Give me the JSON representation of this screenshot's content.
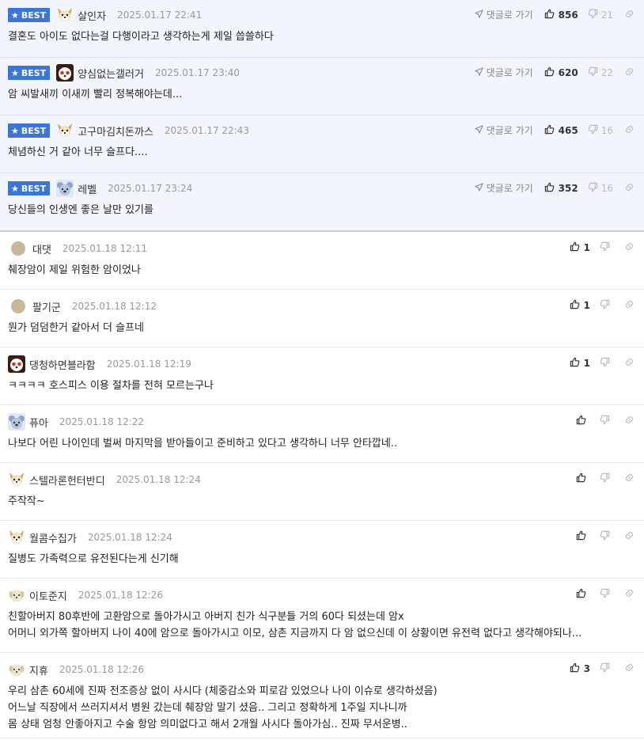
{
  "best_badge": "BEST",
  "reply_label": "댓글로 가기",
  "comments": [
    {
      "best": true,
      "avatar": "dog-avatar",
      "nick": "살인자",
      "date": "2025.01.17 22:41",
      "likes": "856",
      "dislikes": "21",
      "text": "결혼도 아이도 없다는걸 다행이라고 생각하는게 제일 씁쓸하다"
    },
    {
      "best": true,
      "avatar": "panda-avatar",
      "nick": "양심없는갤러거",
      "date": "2025.01.17 23:40",
      "likes": "620",
      "dislikes": "22",
      "text": "암 씨발새끼 이새끼 빨리 정복해야는데..."
    },
    {
      "best": true,
      "avatar": "dog-avatar",
      "nick": "고구마김치돈까스",
      "date": "2025.01.17 22:43",
      "likes": "465",
      "dislikes": "16",
      "text": "체념하신 거 같아 너무 슬프다...."
    },
    {
      "best": true,
      "avatar": "koala-avatar",
      "nick": "레벨",
      "date": "2025.01.17 23:24",
      "likes": "352",
      "dislikes": "16",
      "text": "당신들의 인생엔 좋은 날만 있기를"
    },
    {
      "best": false,
      "avatar": "dot-avatar",
      "nick": "대댓",
      "date": "2025.01.18 12:11",
      "likes": "1",
      "dislikes": "",
      "text": "췌장암이 제일 위험한 암이었나"
    },
    {
      "best": false,
      "avatar": "dot-avatar",
      "nick": "팔기군",
      "date": "2025.01.18 12:12",
      "likes": "1",
      "dislikes": "",
      "text": "뭔가 덤덤한거 같아서 더 슬프네"
    },
    {
      "best": false,
      "avatar": "panda-avatar",
      "nick": "댕청하면블라함",
      "date": "2025.01.18 12:19",
      "likes": "1",
      "dislikes": "",
      "text": "ㅋㅋㅋㅋ 호스피스 이용 절차를 전혀 모르는구나"
    },
    {
      "best": false,
      "avatar": "koala-avatar",
      "nick": "퓨아",
      "date": "2025.01.18 12:22",
      "likes": "",
      "dislikes": "",
      "text": "나보다 어린 나이인데 벌써 마지막을 받아들이고 준비하고 있다고 생각하니 너무 안타깝네.."
    },
    {
      "best": false,
      "avatar": "dog-avatar",
      "nick": "스텔라론헌터반디",
      "date": "2025.01.18 12:24",
      "likes": "",
      "dislikes": "",
      "text": "주작작~"
    },
    {
      "best": false,
      "avatar": "dog-avatar",
      "nick": "월콤수집가",
      "date": "2025.01.18 12:24",
      "likes": "",
      "dislikes": "",
      "text": "질병도 가족력으로 유전된다는게 신기해"
    },
    {
      "best": false,
      "avatar": "puppy-avatar",
      "nick": "이토준지",
      "date": "2025.01.18 12:26",
      "likes": "",
      "dislikes": "",
      "text": "친할아버지 80후반에 고환암으로 돌아가시고 아버지 친가 식구분들 거의 60다 되셨는데 암x\n어머니 외가쪽 할아버지 나이 40에 암으로 돌아가시고 이모, 삼촌 지금까지 다 암 없으신데 이 상황이면 유전력 없다고 생각해야되나..."
    },
    {
      "best": false,
      "avatar": "puppy-avatar",
      "nick": "지휴",
      "date": "2025.01.18 12:26",
      "likes": "3",
      "dislikes": "",
      "text": "우리 삼촌 60세에 진짜 전조증상 없이 사시다 (체중감소와 피로감 있었으나 나이 이슈로 생각하셨음)\n어느날 직장에서 쓰러지셔서 병원 갔는데 췌장암 말기 셨음.. 그리고 정확하게 1주일 지나니까\n몸 상태 엄청 안좋아지고 수술 항암 의미없다고 해서 2개월 사시다 돌아가심.. 진짜 무서운병.."
    }
  ]
}
